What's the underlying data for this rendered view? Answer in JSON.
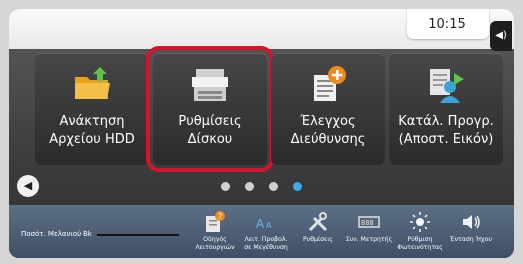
{
  "header": {
    "time": "10:15",
    "volume_icon": "speaker-icon"
  },
  "tiles": [
    {
      "label": "Ανάκτηση\nΑρχείου HDD",
      "icon": "folder-upload-icon",
      "selected": false
    },
    {
      "label": "Ρυθμίσεις\nΔίσκου",
      "icon": "copier-icon",
      "selected": true
    },
    {
      "label": "Έλεγχος\nΔιεύθυνσης",
      "icon": "address-check-icon",
      "selected": false
    },
    {
      "label": "Κατάλ. Προγρ.\n(Αποστ. Εικόν)",
      "icon": "program-list-icon",
      "selected": false
    }
  ],
  "pager": {
    "total": 4,
    "active_index": 3
  },
  "status": {
    "toner_label": "Ποσότ. Μελανιού",
    "toner_color": "Bk"
  },
  "bottom_buttons": [
    {
      "label": "Οδηγός\nΛειτουργιών",
      "icon": "guide-icon"
    },
    {
      "label": "Λειτ. Προβολ.\nσε Μεγέθυνση",
      "icon": "magnify-text-icon"
    },
    {
      "label": "Ρυθμίσεις",
      "icon": "tools-icon"
    },
    {
      "label": "Συν. Μετρητής",
      "icon": "counter-icon"
    },
    {
      "label": "Ρύθμιση\nΦωτεινότητας",
      "icon": "brightness-icon"
    },
    {
      "label": "Ένταση Ήχου",
      "icon": "speaker-icon"
    }
  ],
  "colors": {
    "selection": "#d4142a",
    "active_dot": "#3da9f0"
  }
}
